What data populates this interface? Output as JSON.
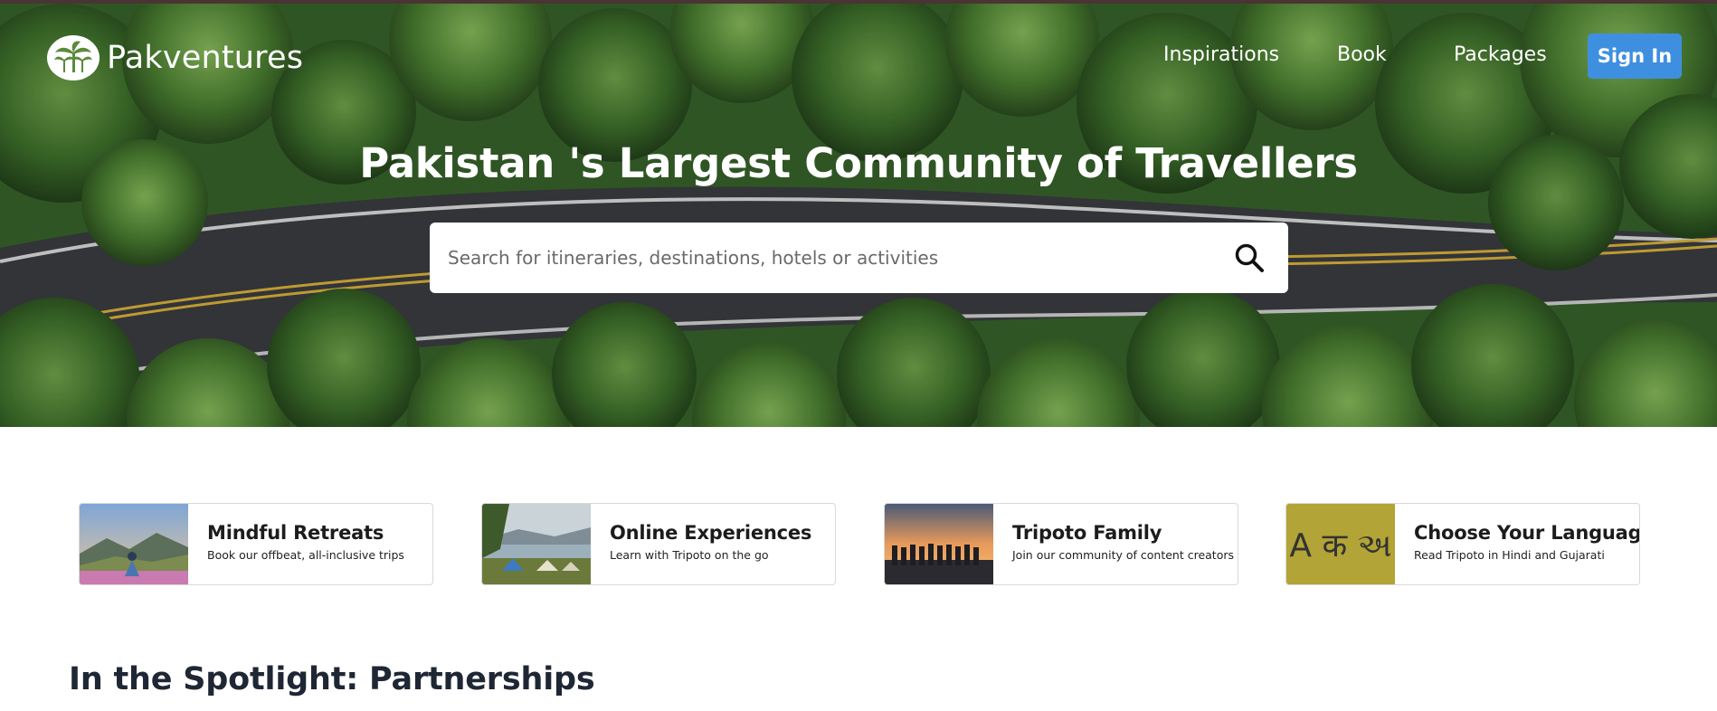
{
  "header": {
    "brand": "Pakventures",
    "nav": [
      {
        "label": "Inspirations"
      },
      {
        "label": "Book"
      },
      {
        "label": "Packages"
      }
    ],
    "signin_label": "Sign In"
  },
  "hero": {
    "title": "Pakistan 's Largest Community of Travellers",
    "search_placeholder": "Search for itineraries, destinations, hotels or activities"
  },
  "cards": [
    {
      "title": "Mindful Retreats",
      "subtitle": "Book our offbeat, all-inclusive trips"
    },
    {
      "title": "Online Experiences",
      "subtitle": "Learn with Tripoto on the go"
    },
    {
      "title": "Tripoto Family",
      "subtitle": "Join our community of content creators"
    },
    {
      "title": "Choose Your Language",
      "subtitle": "Read Tripoto in Hindi and Gujarati",
      "thumb_text": "A क અ"
    }
  ],
  "spotlight": {
    "title": "In the Spotlight: Partnerships"
  },
  "colors": {
    "primary": "#3f8fe0",
    "forest": "#2f5a23",
    "language_tile": "#b2a436"
  }
}
